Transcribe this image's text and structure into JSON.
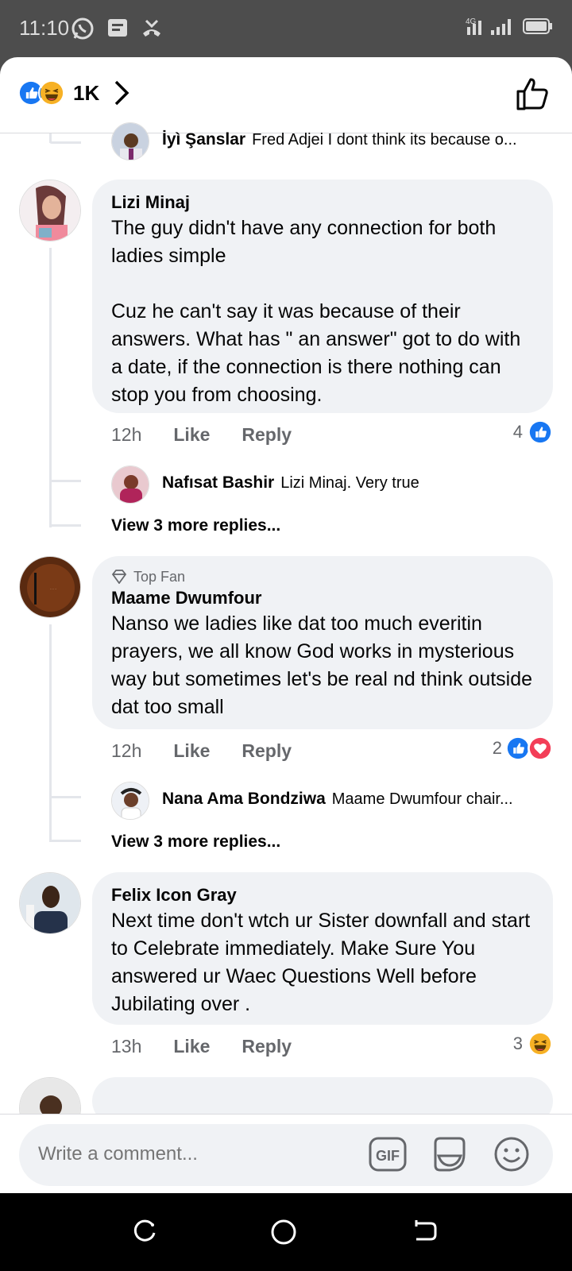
{
  "status_bar": {
    "time": "11:10",
    "network": "4G"
  },
  "header": {
    "reaction_count": "1K"
  },
  "partial_reply": {
    "author": "İyì Şanslar",
    "text": "Fred Adjei I dont think its because o..."
  },
  "comments": [
    {
      "author": "Lizi Minaj",
      "badge": "",
      "text": "The guy didn't have any connection for both ladies simple\n\nCuz he can't say it was because of their answers. What has \" an answer\" got to do with a date, if the connection is there nothing can stop you from choosing.",
      "time": "12h",
      "like_label": "Like",
      "reply_label": "Reply",
      "reaction_count": "4",
      "reply_preview": {
        "author": "Nafısat Bashir",
        "text": "Lizi Minaj. Very true"
      },
      "more_replies": "View 3 more replies..."
    },
    {
      "author": "Maame Dwumfour",
      "badge": "Top Fan",
      "text": "Nanso we ladies like dat too much everitin prayers, we all know God works in mysterious way but sometimes let's be real nd think outside dat too small",
      "time": "12h",
      "like_label": "Like",
      "reply_label": "Reply",
      "reaction_count": "2",
      "reply_preview": {
        "author": "Nana Ama Bondziwa",
        "text": "Maame Dwumfour chair..."
      },
      "more_replies": "View 3 more replies..."
    },
    {
      "author": "Felix Icon Gray",
      "badge": "",
      "text": "Next time don't wtch ur Sister downfall and start to Celebrate immediately. Make Sure You answered ur Waec Questions Well before Jubilating over .",
      "time": "13h",
      "like_label": "Like",
      "reply_label": "Reply",
      "reaction_count": "3"
    }
  ],
  "composer": {
    "placeholder": "Write a comment...",
    "gif_label": "GIF"
  },
  "colors": {
    "like_blue": "#1877f2",
    "bubble": "#f0f2f5",
    "secondary_text": "#65676b",
    "love_red": "#f33e58",
    "haha_yellow": "#f7b125"
  },
  "icons": [
    "whatsapp-icon",
    "message-icon",
    "missed-call-icon",
    "signal-icon",
    "battery-icon",
    "like-reaction-icon",
    "haha-reaction-icon",
    "love-reaction-icon",
    "chevron-right-icon",
    "like-outline-icon",
    "diamond-icon",
    "gif-icon",
    "sticker-icon",
    "emoji-icon",
    "recent-apps-icon",
    "home-icon",
    "back-icon"
  ]
}
